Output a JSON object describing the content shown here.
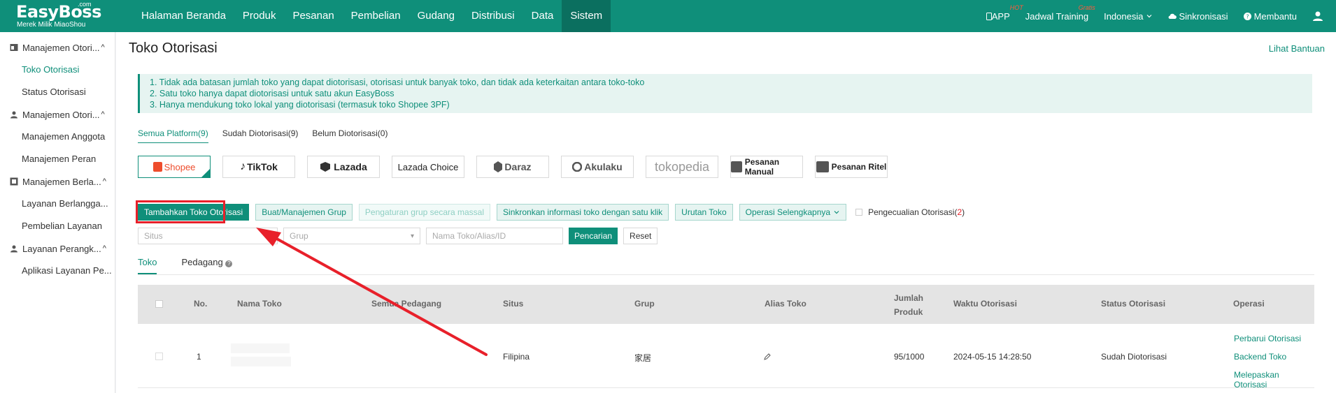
{
  "brand": {
    "name": "EasyBoss",
    "com": ".com",
    "tagline": "Merek Milik MiaoShou"
  },
  "nav": [
    "Halaman Beranda",
    "Produk",
    "Pesanan",
    "Pembelian",
    "Gudang",
    "Distribusi",
    "Data",
    "Sistem"
  ],
  "nav_active": "Sistem",
  "top_right": {
    "app": "APP",
    "app_badge": "HOT",
    "training": "Jadwal Training",
    "training_badge": "Gratis",
    "language": "Indonesia",
    "sync": "Sinkronisasi",
    "help": "Membantu"
  },
  "sidebar": [
    {
      "group": "Manajemen Otori...",
      "items": [
        "Toko Otorisasi",
        "Status Otorisasi"
      ]
    },
    {
      "group": "Manajemen Otori...",
      "items": [
        "Manajemen Anggota",
        "Manajemen Peran"
      ]
    },
    {
      "group": "Manajemen Berla...",
      "items": [
        "Layanan Berlangga...",
        "Pembelian Layanan"
      ]
    },
    {
      "group": "Layanan Perangk...",
      "items": [
        "Aplikasi Layanan Pe..."
      ]
    }
  ],
  "page": {
    "title": "Toko Otorisasi",
    "help_link": "Lihat Bantuan"
  },
  "notice": [
    "1. Tidak ada batasan jumlah toko yang dapat diotorisasi, otorisasi untuk banyak toko, dan tidak ada keterkaitan antara toko-toko",
    "2. Satu toko hanya dapat diotorisasi untuk satu akun EasyBoss",
    "3. Hanya mendukung toko lokal yang diotorisasi (termasuk toko Shopee 3PF)"
  ],
  "platform_tabs": [
    "Semua Platform(9)",
    "Sudah Diotorisasi(9)",
    "Belum Diotorisasi(0)"
  ],
  "platforms": [
    "Shopee",
    "TikTok",
    "Lazada",
    "Lazada Choice",
    "Daraz",
    "Akulaku",
    "tokopedia",
    "Pesanan Manual",
    "Pesanan Ritel"
  ],
  "actions": {
    "add": "Tambahkan Toko Otorisasi",
    "group": "Buat/Manajemen Grup",
    "bulk": "Pengaturan grup secara massal",
    "sync": "Sinkronkan informasi toko dengan satu klik",
    "order": "Urutan Toko",
    "more": "Operasi Selengkapnya",
    "exception": "Pengecualian Otorisasi(",
    "exception_count": "2",
    "exception_close": ")"
  },
  "filters": {
    "site_placeholder": "Situs",
    "group_placeholder": "Grup",
    "name_placeholder": "Nama Toko/Alias/ID",
    "search": "Pencarian",
    "reset": "Reset"
  },
  "sub_tabs": [
    "Toko",
    "Pedagang"
  ],
  "table": {
    "headers": {
      "no": "No.",
      "name": "Nama Toko",
      "merchant": "Semua Pedagang",
      "site": "Situs",
      "group": "Grup",
      "alias": "Alias Toko",
      "qty_1": "Jumlah",
      "qty_2": "Produk",
      "time": "Waktu Otorisasi",
      "status": "Status Otorisasi",
      "ops": "Operasi"
    },
    "rows": [
      {
        "no": "1",
        "site": "Filipina",
        "group": "家居",
        "qty": "95/1000",
        "time": "2024-05-15 14:28:50",
        "status": "Sudah Diotorisasi",
        "ops": [
          "Perbarui Otorisasi",
          "Backend Toko",
          "Melepaskan Otorisasi"
        ]
      }
    ]
  },
  "colors": {
    "brand": "#0f8f7a",
    "highlight": "#e8202a"
  }
}
